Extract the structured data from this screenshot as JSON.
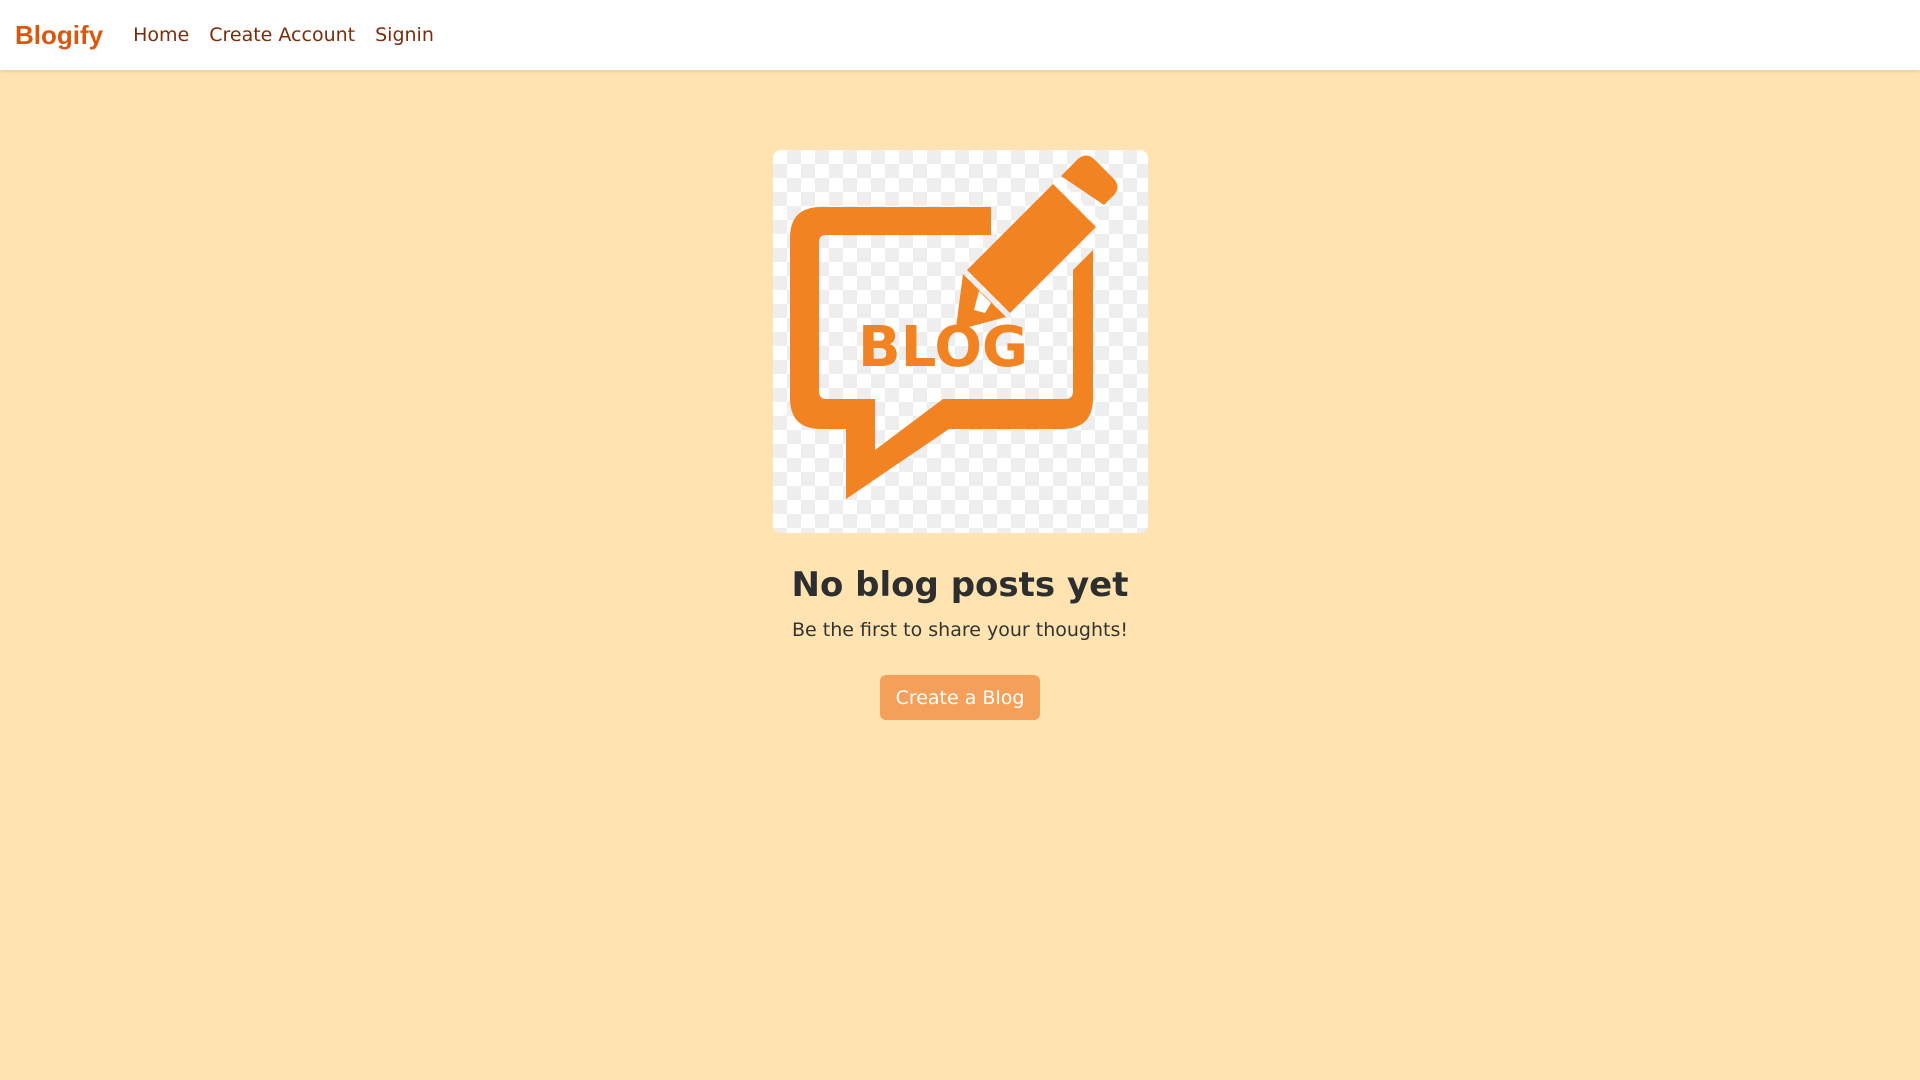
{
  "navbar": {
    "brand": "Blogify",
    "links": [
      {
        "label": "Home"
      },
      {
        "label": "Create Account"
      },
      {
        "label": "Signin"
      }
    ]
  },
  "main": {
    "logo": {
      "text": "BLOG",
      "icon": "blog-speech-bubble-pencil-logo"
    },
    "title": "No blog posts yet",
    "subtitle": "Be the first to share your thoughts!",
    "cta_label": "Create a Blog"
  },
  "colors": {
    "background": "#ffe4b2",
    "brand": "#d9580f",
    "nav_link": "#7a2c0a",
    "logo_orange": "#f28322",
    "button": "#f5a05a"
  }
}
